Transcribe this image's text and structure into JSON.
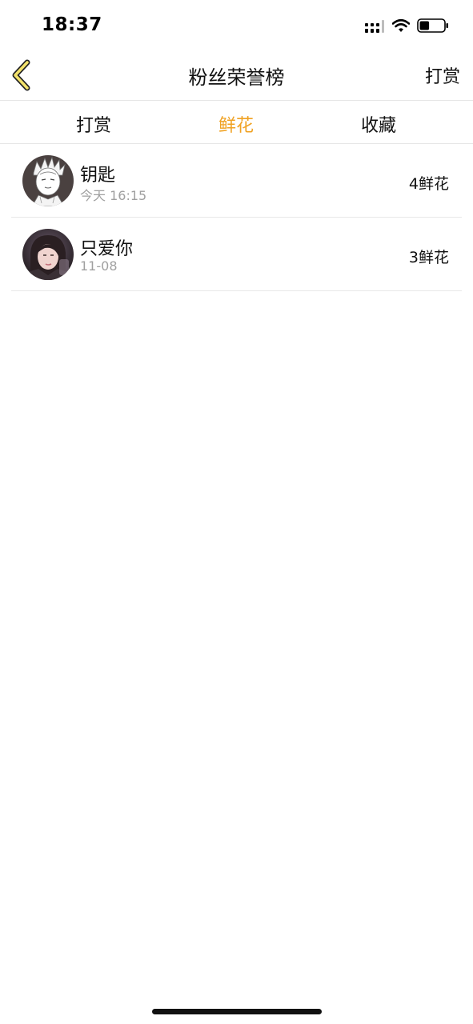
{
  "status_bar": {
    "time": "18:37",
    "icons": [
      "signal-icon",
      "wifi-icon",
      "battery-icon"
    ],
    "battery_level": 0.4
  },
  "nav": {
    "back_icon": "chevron-left-icon",
    "title": "粉丝荣誉榜",
    "action_label": "打赏"
  },
  "tabs": [
    {
      "label": "打赏",
      "active": false
    },
    {
      "label": "鲜花",
      "active": true
    },
    {
      "label": "收藏",
      "active": false
    }
  ],
  "colors": {
    "accent": "#f0a223",
    "back_icon_fill": "#f3e26b",
    "divider": "#e6e6e6",
    "secondary_text": "#a0a0a0"
  },
  "list": [
    {
      "name": "钥匙",
      "time": "今天 16:15",
      "count": "4鲜花",
      "avatar": "avatar-sketch"
    },
    {
      "name": "只爱你",
      "time": "11-08",
      "count": "3鲜花",
      "avatar": "avatar-photo"
    }
  ]
}
